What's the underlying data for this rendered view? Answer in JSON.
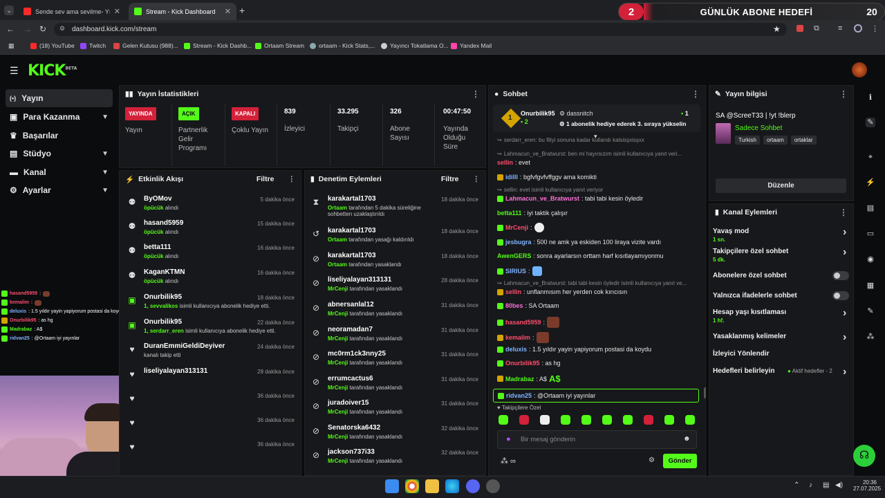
{
  "browser": {
    "tabs": [
      {
        "label": "Sende sev ama sevilme- Yıldız T",
        "color": "#ff2a2a"
      },
      {
        "label": "Stream - Kick Dashboard",
        "color": "#53fc18"
      }
    ],
    "url": "dashboard.kick.com/stream",
    "bookmarks": [
      {
        "label": "(18) YouTube",
        "color": "#ff2a2a"
      },
      {
        "label": "Twitch",
        "color": "#9146ff"
      },
      {
        "label": "Gelen Kutusu (988)...",
        "color": "#d44"
      },
      {
        "label": "Stream - Kick Dashb...",
        "color": "#53fc18"
      },
      {
        "label": "Ortaam Stream",
        "color": "#53fc18"
      },
      {
        "label": "ortaam - Kick Stats,...",
        "color": "#8aa"
      },
      {
        "label": "Yayıncı Tokatlama O...",
        "color": "#ccc"
      },
      {
        "label": "Yandex Mail",
        "color": "#f4a"
      }
    ]
  },
  "goal": {
    "number": "2",
    "title": "GÜNLÜK ABONE HEDEFİ",
    "target": "20"
  },
  "brand": {
    "logo": "KICK",
    "beta": "BETA",
    "accent": "#53fc18"
  },
  "nav": [
    {
      "label": "Yayın",
      "icon": "broadcast-icon"
    },
    {
      "label": "Para Kazanma",
      "icon": "wallet-icon"
    },
    {
      "label": "Başarılar",
      "icon": "trophy-icon"
    },
    {
      "label": "Stüdyo",
      "icon": "studio-icon"
    },
    {
      "label": "Kanal",
      "icon": "channel-icon"
    },
    {
      "label": "Ayarlar",
      "icon": "gear-icon"
    }
  ],
  "stats": {
    "title": "Yayın İstatistikleri",
    "items": [
      {
        "badge": "YAYINDA",
        "label": "Yayın",
        "color": "#d3213a"
      },
      {
        "badge": "AÇIK",
        "label": "Partnerlik Gelir Programı",
        "color": "#53fc18"
      },
      {
        "badge": "KAPALI",
        "label": "Çoklu Yayın",
        "color": "#d3213a"
      },
      {
        "value": "839",
        "label": "İzleyici"
      },
      {
        "value": "33.295",
        "label": "Takipçi"
      },
      {
        "value": "326",
        "label": "Abone Sayısı"
      },
      {
        "value": "00:47:50",
        "label": "Yayında Olduğu Süre"
      }
    ]
  },
  "activity": {
    "title": "Etkinlik Akışı",
    "filter": "Filtre",
    "items": [
      {
        "name": "ByOMov",
        "sub": "öpücük",
        "rest": "alındı",
        "time": "5 dakika önce"
      },
      {
        "name": "hasand5959",
        "sub": "öpücük",
        "rest": "alındı",
        "time": "15 dakika önce"
      },
      {
        "name": "betta111",
        "sub": "öpücük",
        "rest": "alındı",
        "time": "16 dakika önce"
      },
      {
        "name": "KaganKTMN",
        "sub": "öpücük",
        "rest": "alındı",
        "time": "16 dakika önce"
      },
      {
        "name": "Onurbilik95",
        "sub": "1, sevvalikos",
        "rest": "isimli kullanıcıya abonelik hediye etti.",
        "time": "18 dakika önce"
      },
      {
        "name": "Onurbilik95",
        "sub": "1, serdarr_eren",
        "rest": "isimli kullanıcıya abonelik hediye etti.",
        "time": "22 dakika önce"
      },
      {
        "name": "DuranEmmiGeldiDeyiver",
        "sub": "",
        "rest": "kanalı takip etti",
        "time": "24 dakika önce"
      },
      {
        "name": "liseliyalayan313131",
        "sub": "",
        "rest": "",
        "time": "28 dakika önce"
      },
      {
        "name": "",
        "sub": "",
        "rest": "",
        "time": "36 dakika önce"
      },
      {
        "name": "",
        "sub": "",
        "rest": "",
        "time": "36 dakika önce"
      },
      {
        "name": "",
        "sub": "",
        "rest": "",
        "time": "36 dakika önce"
      }
    ]
  },
  "moderation": {
    "title": "Denetim Eylemleri",
    "filter": "Filtre",
    "items": [
      {
        "name": "karakartal1703",
        "by": "Ortaam",
        "rest": "tarafından 5 dakika süreliğine sohbetten uzaklaştırıldı",
        "time": "18 dakika önce"
      },
      {
        "name": "karakartal1703",
        "by": "Ortaam",
        "rest": "tarafından yasağı kaldırıldı",
        "time": "18 dakika önce"
      },
      {
        "name": "karakartal1703",
        "by": "Ortaam",
        "rest": "tarafından yasaklandı",
        "time": "18 dakika önce"
      },
      {
        "name": "liseliyalayan313131",
        "by": "MrCenji",
        "rest": "tarafından yasaklandı",
        "time": "28 dakika önce"
      },
      {
        "name": "abnersanlal12",
        "by": "MrCenji",
        "rest": "tarafından yasaklandı",
        "time": "31 dakika önce"
      },
      {
        "name": "neoramadan7",
        "by": "MrCenji",
        "rest": "tarafından yasaklandı",
        "time": "31 dakika önce"
      },
      {
        "name": "mc0rm1ck3nny25",
        "by": "MrCenji",
        "rest": "tarafından yasaklandı",
        "time": "31 dakika önce"
      },
      {
        "name": "errumcactus6",
        "by": "MrCenji",
        "rest": "tarafından yasaklandı",
        "time": "31 dakika önce"
      },
      {
        "name": "juradoiver15",
        "by": "MrCenji",
        "rest": "tarafından yasaklandı",
        "time": "31 dakika önce"
      },
      {
        "name": "Senatorska6432",
        "by": "MrCenji",
        "rest": "tarafından yasaklandı",
        "time": "32 dakika önce"
      },
      {
        "name": "jackson737i33",
        "by": "MrCenji",
        "rest": "tarafından yasaklandı",
        "time": "32 dakika önce"
      }
    ]
  },
  "chat": {
    "title": "Sohbet",
    "pinned": {
      "user1": "Onurbilik95",
      "count1": "2",
      "user2": "dassnitch",
      "count2": "1",
      "msg": "1 abonelik hediye ederek 3. sıraya yükselin",
      "rank": "1"
    },
    "lines": [
      {
        "type": "reply",
        "text": "serdarr_eren: bu filiyi sonuna kadar kullandı kalsisşxisşxx"
      },
      {
        "type": "reply",
        "text": "Lahmacun_ve_Bratwurst: ben mi hayırsızım isimli kullanıcıya yanıt veri..."
      },
      {
        "user": "sellin",
        "color": "#ff4d6d",
        "text": ": evet"
      },
      {
        "user": "idilll",
        "color": "#7fb3ff",
        "text": ": bgfvfgvfvffggv ama komikti"
      },
      {
        "type": "reply",
        "text": "sellin: evet isimli kullanıcıya yanıt veriyor"
      },
      {
        "user": "Lahmacun_ve_Bratwurst",
        "color": "#ff6fd8",
        "text": ": tabi tabi kesin öyledir"
      },
      {
        "user": "betta111",
        "color": "#53fc18",
        "text": ": iyi taktik çalışır"
      },
      {
        "user": "MrCenji",
        "color": "#ff4d6d",
        "text": ":"
      },
      {
        "user": "jesbugra",
        "color": "#7fb3ff",
        "text": ": 500 ne amk ya eskiden 100 liraya vizite vardı"
      },
      {
        "user": "AwenGERS",
        "color": "#53fc18",
        "text": ": sonra ayarlarsın orttam harf kısıtlayamıyonmu"
      },
      {
        "user": "SIRIUS",
        "color": "#7fb3ff",
        "text": ":"
      },
      {
        "type": "reply",
        "text": "Lahmacun_ve_Bratwurst: tabi tabi kesin öyledir isimli kullanıcıya yanıt ve..."
      },
      {
        "user": "sellin",
        "color": "#ff4d6d",
        "text": ": unflanmısım her yerden cok kırıcısın"
      },
      {
        "user": "80bes",
        "color": "#ff6fd8",
        "text": ": SA Ortaam"
      },
      {
        "user": "hasand5959",
        "color": "#ff4d6d",
        "text": ":"
      },
      {
        "user": "kemalim",
        "color": "#ff4d6d",
        "text": ":"
      },
      {
        "user": "deluxis",
        "color": "#7fb3ff",
        "text": ": 1.5 yıldır yayin yapiyorum postasi da koydu"
      },
      {
        "user": "Onurbilik95",
        "color": "#ff4d6d",
        "text": ": as hg"
      },
      {
        "user": "Madrabaz",
        "color": "#53fc18",
        "text": ": A$"
      },
      {
        "user": "ridvan25",
        "color": "#7fb3ff",
        "text": ": @Ortaam iyi yayınlar"
      }
    ],
    "followers_only": "Takipçilere Özel",
    "input_placeholder": "Bir mesaj gönderin",
    "send": "Gönder"
  },
  "stream_info": {
    "title": "Yayın bilgisi",
    "stream_title": "SA @ScreeT33 | !yt !blerp",
    "category": "Sadece Sohbet",
    "tags": [
      "Turkish",
      "ortaam",
      "ortaklar"
    ],
    "edit": "Düzenle"
  },
  "channel_actions": {
    "title": "Kanal Eylemleri",
    "items": [
      {
        "label": "Yavaş mod",
        "sub": "1 sn.",
        "control": "arrow"
      },
      {
        "label": "Takipçilere özel sohbet",
        "sub": "5 dk.",
        "control": "arrow"
      },
      {
        "label": "Abonelere özel sohbet",
        "sub": "",
        "control": "toggle"
      },
      {
        "label": "Yalnızca ifadelerle sohbet",
        "sub": "",
        "control": "toggle"
      },
      {
        "label": "Hesap yaşı kısıtlaması",
        "sub": "1 hf.",
        "control": "arrow"
      },
      {
        "label": "Yasaklanmış kelimeler",
        "sub": "",
        "control": "arrow"
      },
      {
        "label": "İzleyici Yönlendir",
        "sub": "",
        "control": "none"
      },
      {
        "label": "Hedefleri belirleyin",
        "sub": "",
        "control": "arrow",
        "extra": "Aktif hedefler - 2"
      }
    ]
  },
  "overlay_chat": [
    {
      "user": "hasand5959",
      "text": ":"
    },
    {
      "user": "kemalim",
      "text": ":"
    },
    {
      "user": "deluxis",
      "text": ": 1.5 yıldır yayin yapiyorum postasi da koydu"
    },
    {
      "user": "Onurbilik95",
      "text": ": as hg"
    },
    {
      "user": "Madrabaz",
      "text": ": A$"
    },
    {
      "user": "ridvan25",
      "text": ": @Ortaam iyi yayınlar"
    }
  ],
  "taskbar": {
    "time": "20:36",
    "date": "27.07.2025"
  }
}
